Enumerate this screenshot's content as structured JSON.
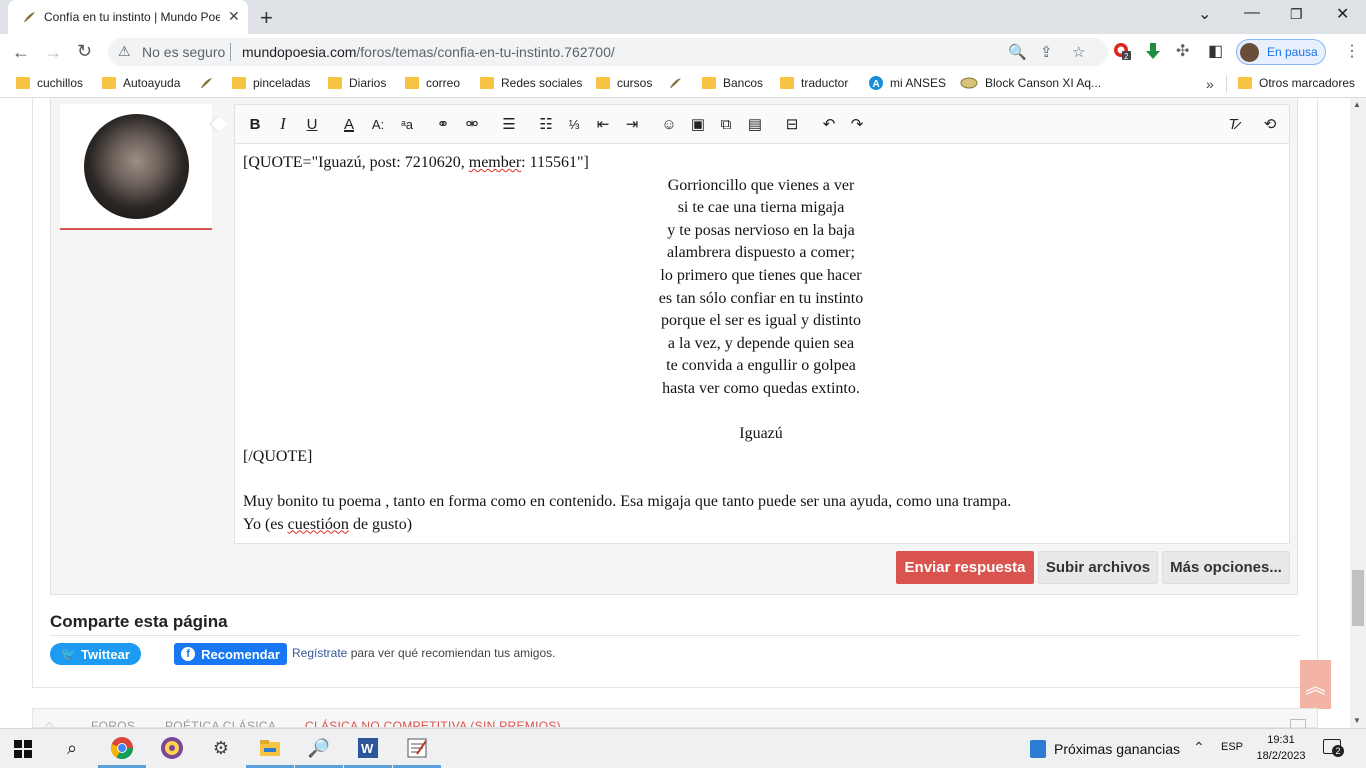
{
  "browser": {
    "tab_title": "Confía en tu instinto | Mundo Poesía",
    "security_label": "No es seguro",
    "url_host": "mundopoesia.com",
    "url_path": "/foros/temas/confia-en-tu-instinto.762700/",
    "profile_label": "En pausa",
    "ext_badge": "2"
  },
  "bookmarks": [
    {
      "label": "cuchillos",
      "icon": "folder"
    },
    {
      "label": "Autoayuda",
      "icon": "folder"
    },
    {
      "label": "",
      "icon": "mundopoesia-feather"
    },
    {
      "label": "pinceladas",
      "icon": "folder"
    },
    {
      "label": "Diarios",
      "icon": "folder"
    },
    {
      "label": "correo",
      "icon": "folder"
    },
    {
      "label": "Redes sociales",
      "icon": "folder"
    },
    {
      "label": "cursos",
      "icon": "folder"
    },
    {
      "label": "",
      "icon": "mundopoesia-feather"
    },
    {
      "label": "Bancos",
      "icon": "folder"
    },
    {
      "label": "traductor",
      "icon": "folder"
    },
    {
      "label": "mi ANSES",
      "icon": "anses-logo"
    },
    {
      "label": "Block Canson XI Aq...",
      "icon": "canson-logo"
    }
  ],
  "bookmarks_more": "»",
  "other_bookmarks": "Otros marcadores",
  "editor": {
    "quote_open_prefix": "[QUOTE=\"Iguazú, post: 7210620, ",
    "quote_open_member": "member",
    "quote_open_suffix": ": 115561\"]",
    "poem": [
      "Gorrioncillo que vienes a ver",
      "si te cae una tierna migaja",
      "y te posas nervioso en la baja",
      "alambrera dispuesto a comer;",
      "lo primero que tienes que hacer",
      "es tan sólo confiar en tu instinto",
      "porque el ser es igual y distinto",
      "a la vez, y depende quien sea",
      "te convida a engullir o golpea",
      "hasta ver como quedas extinto."
    ],
    "poem_author": "Iguazú",
    "quote_close": "[/QUOTE]",
    "reply_line1": "Muy bonito tu poema , tanto en forma como en contenido. Esa migaja que tanto puede ser una ayuda, como una trampa.",
    "reply_line2_prefix": "Yo (es ",
    "reply_line2_misspelled": "cuestióon",
    "reply_line2_suffix": " de gusto)"
  },
  "buttons": {
    "send": "Enviar respuesta",
    "upload": "Subir archivos",
    "more": "Más opciones..."
  },
  "share": {
    "heading": "Comparte esta página",
    "tweet": "Twittear",
    "recommend": "Recomendar",
    "signup_link": "Regístrate",
    "signup_text": " para ver qué recomiendan tus amigos."
  },
  "breadcrumbs": [
    "FOROS",
    "POÉTICA CLÁSICA",
    "CLÁSICA NO COMPETITIVA (SIN PREMIOS)"
  ],
  "taskbar": {
    "widget_label": "Próximas ganancias",
    "language": "ESP",
    "time": "19:31",
    "date": "18/2/2023",
    "notifications": "2"
  },
  "colors": {
    "accent_red": "#d9534f",
    "twitter_blue": "#1d9bf0",
    "facebook_blue": "#1877f2"
  }
}
